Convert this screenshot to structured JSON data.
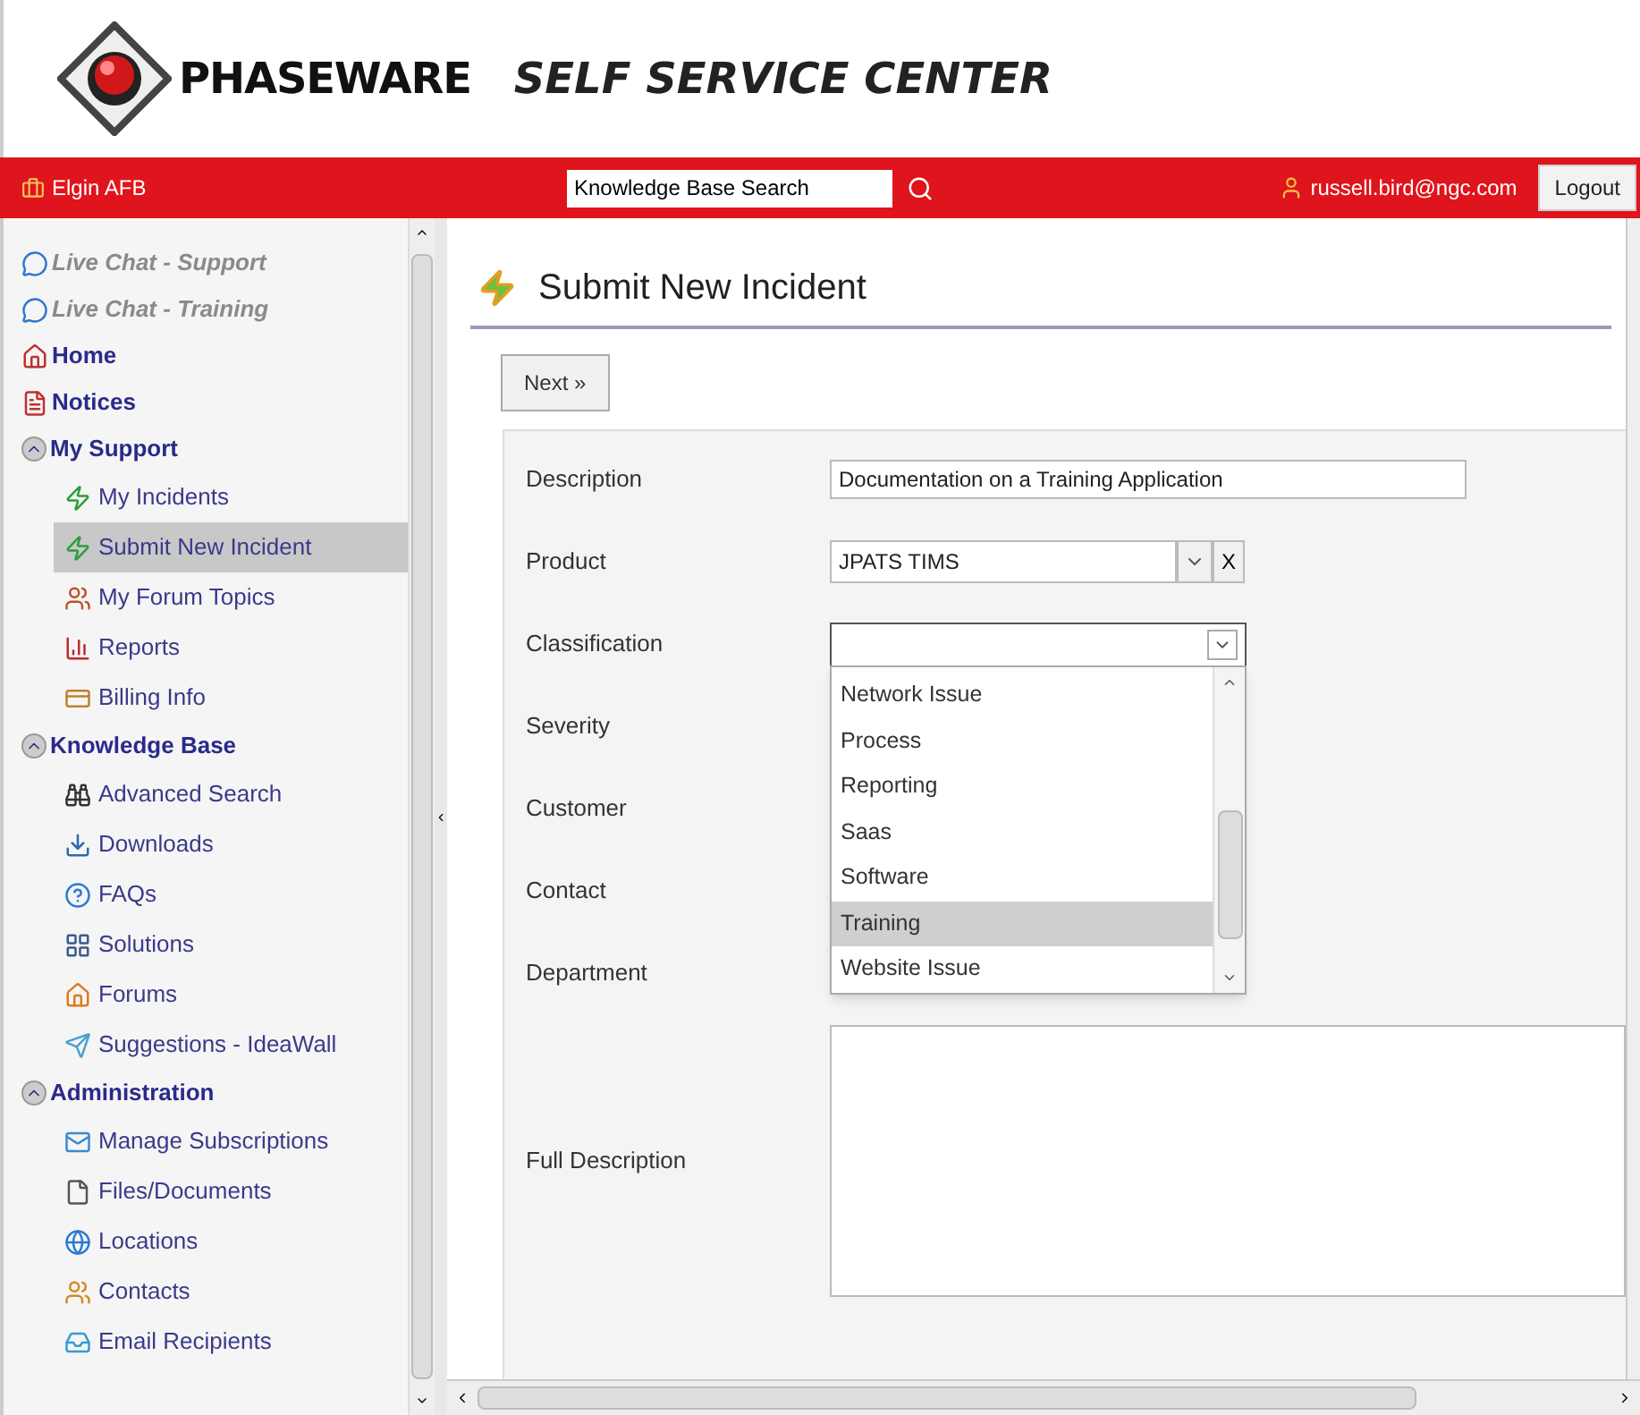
{
  "header": {
    "brand": "PHASEWARE",
    "title": "SELF SERVICE CENTER"
  },
  "topbar": {
    "location": "Elgin AFB",
    "search": {
      "value": "Knowledge Base Search"
    },
    "user": "russell.bird@ngc.com",
    "logout": "Logout"
  },
  "sidebar": {
    "items": [
      {
        "label": "Live Chat - Support",
        "kind": "chat",
        "selected": false
      },
      {
        "label": "Live Chat - Training",
        "kind": "chat",
        "selected": false
      },
      {
        "label": "Home",
        "kind": "top",
        "selected": false
      },
      {
        "label": "Notices",
        "kind": "top",
        "selected": false
      },
      {
        "label": "My Support",
        "kind": "section",
        "expanded": true,
        "selected": false,
        "children": [
          {
            "label": "My Incidents",
            "selected": false
          },
          {
            "label": "Submit New Incident",
            "selected": true
          },
          {
            "label": "My Forum Topics",
            "selected": false
          },
          {
            "label": "Reports",
            "selected": false
          },
          {
            "label": "Billing Info",
            "selected": false
          }
        ]
      },
      {
        "label": "Knowledge Base",
        "kind": "section",
        "expanded": true,
        "selected": false,
        "children": [
          {
            "label": "Advanced Search",
            "selected": false
          },
          {
            "label": "Downloads",
            "selected": false
          },
          {
            "label": "FAQs",
            "selected": false
          },
          {
            "label": "Solutions",
            "selected": false
          },
          {
            "label": "Forums",
            "selected": false
          },
          {
            "label": "Suggestions - IdeaWall",
            "selected": false
          }
        ]
      },
      {
        "label": "Administration",
        "kind": "section",
        "expanded": true,
        "selected": false,
        "children": [
          {
            "label": "Manage Subscriptions",
            "selected": false
          },
          {
            "label": "Files/Documents",
            "selected": false
          },
          {
            "label": "Locations",
            "selected": false
          },
          {
            "label": "Contacts",
            "selected": false
          },
          {
            "label": "Email Recipients",
            "selected": false
          }
        ]
      }
    ]
  },
  "page": {
    "title": "Submit New Incident",
    "next_button": "Next »"
  },
  "form": {
    "fields": [
      {
        "label": "Description",
        "kind": "text",
        "value": "Documentation on a Training Application"
      },
      {
        "label": "Product",
        "kind": "combo",
        "value": "JPATS TIMS",
        "clear": "X"
      },
      {
        "label": "Classification",
        "kind": "select",
        "open": true,
        "options": [
          {
            "label": "Network Issue",
            "selected": false
          },
          {
            "label": "Process",
            "selected": false
          },
          {
            "label": "Reporting",
            "selected": false
          },
          {
            "label": "Saas",
            "selected": false
          },
          {
            "label": "Software",
            "selected": false
          },
          {
            "label": "Training",
            "selected": true
          },
          {
            "label": "Website Issue",
            "selected": false
          }
        ]
      },
      {
        "label": "Severity",
        "kind": "hidden"
      },
      {
        "label": "Customer",
        "kind": "hidden"
      },
      {
        "label": "Contact",
        "kind": "hidden"
      },
      {
        "label": "Department",
        "kind": "hidden"
      },
      {
        "label": "Full Description",
        "kind": "textarea"
      }
    ]
  }
}
